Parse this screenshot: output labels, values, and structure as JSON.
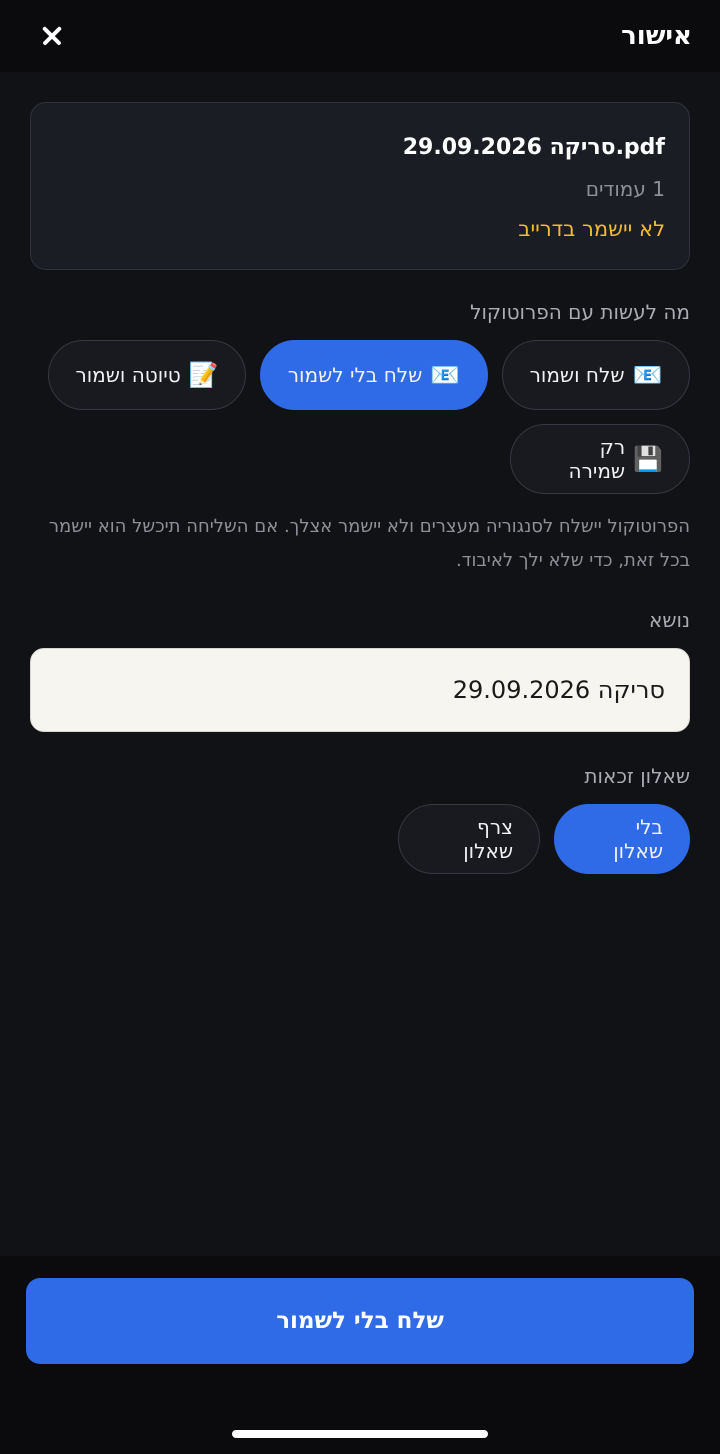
{
  "header": {
    "title": "אישור",
    "close_icon": "close-icon"
  },
  "file": {
    "name": "סריקה 29.09.2026.pdf",
    "pages": "1 עמודים",
    "drive_status": "לא יישמר בדרייב"
  },
  "actions": {
    "label": "מה לעשות עם הפרוטוקול",
    "options": [
      {
        "emoji": "📧",
        "label": "שלח ושמור",
        "selected": false
      },
      {
        "emoji": "📧",
        "label": "שלח בלי לשמור",
        "selected": true
      },
      {
        "emoji": "📝",
        "label": "טיוטה ושמור",
        "selected": false
      },
      {
        "emoji": "💾",
        "label": "רק שמירה",
        "selected": false
      }
    ],
    "description": "הפרוטוקול יישלח לסנגוריה מעצרים ולא יישמר אצלך. אם השליחה תיכשל הוא יישמר בכל זאת, כדי שלא ילך לאיבוד."
  },
  "subject": {
    "label": "נושא",
    "value": "סריקה 29.09.2026"
  },
  "questionnaire": {
    "label": "שאלון זכאות",
    "options": [
      {
        "label": "בלי שאלון",
        "selected": true
      },
      {
        "label": "צרף שאלון",
        "selected": false
      }
    ]
  },
  "footer": {
    "button_label": "שלח בלי לשמור"
  },
  "colors": {
    "accent": "#2f6be6",
    "warning": "#f5b932",
    "background": "#111216"
  }
}
